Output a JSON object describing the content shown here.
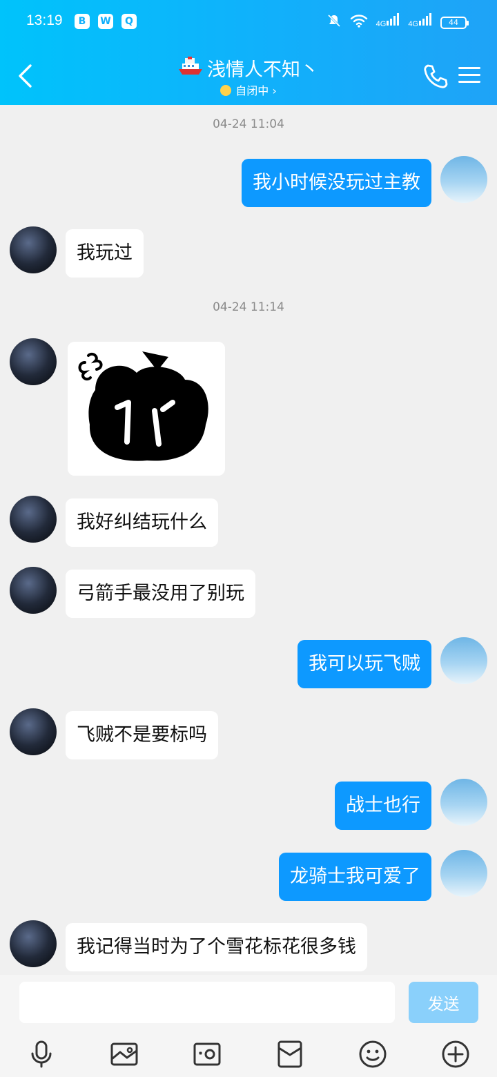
{
  "status_bar": {
    "time": "13:19",
    "app_icons": [
      "B",
      "W",
      "Q"
    ],
    "signal1": "4G",
    "signal2": "4G",
    "battery": "44"
  },
  "header": {
    "title": "浅情人不知丶",
    "subtitle": "自闭中",
    "back_icon": "chevron-left-icon",
    "call_icon": "phone-icon",
    "menu_icon": "menu-icon"
  },
  "timestamps": [
    "04-24 11:04",
    "04-24 11:14"
  ],
  "messages": [
    {
      "from": "me",
      "text": "我小时候没玩过主教"
    },
    {
      "from": "other",
      "text": "我玩过"
    },
    {
      "from": "other",
      "type": "sticker"
    },
    {
      "from": "other",
      "text": "我好纠结玩什么"
    },
    {
      "from": "other",
      "text": "弓箭手最没用了别玩"
    },
    {
      "from": "me",
      "text": "我可以玩飞贼"
    },
    {
      "from": "other",
      "text": "飞贼不是要标吗"
    },
    {
      "from": "me",
      "text": "战士也行"
    },
    {
      "from": "me",
      "text": "龙骑士我可爱了"
    },
    {
      "from": "other",
      "text": "我记得当时为了个雪花标花很多钱"
    }
  ],
  "input": {
    "value": "",
    "placeholder": "",
    "send_label": "发送"
  },
  "toolbar": [
    "microphone-icon",
    "image-icon",
    "camera-icon",
    "red-packet-icon",
    "emoji-icon",
    "plus-icon"
  ],
  "colors": {
    "header": "#11b0fb",
    "my_bubble": "#0d99ff",
    "send_disabled": "#8ad0fb"
  }
}
